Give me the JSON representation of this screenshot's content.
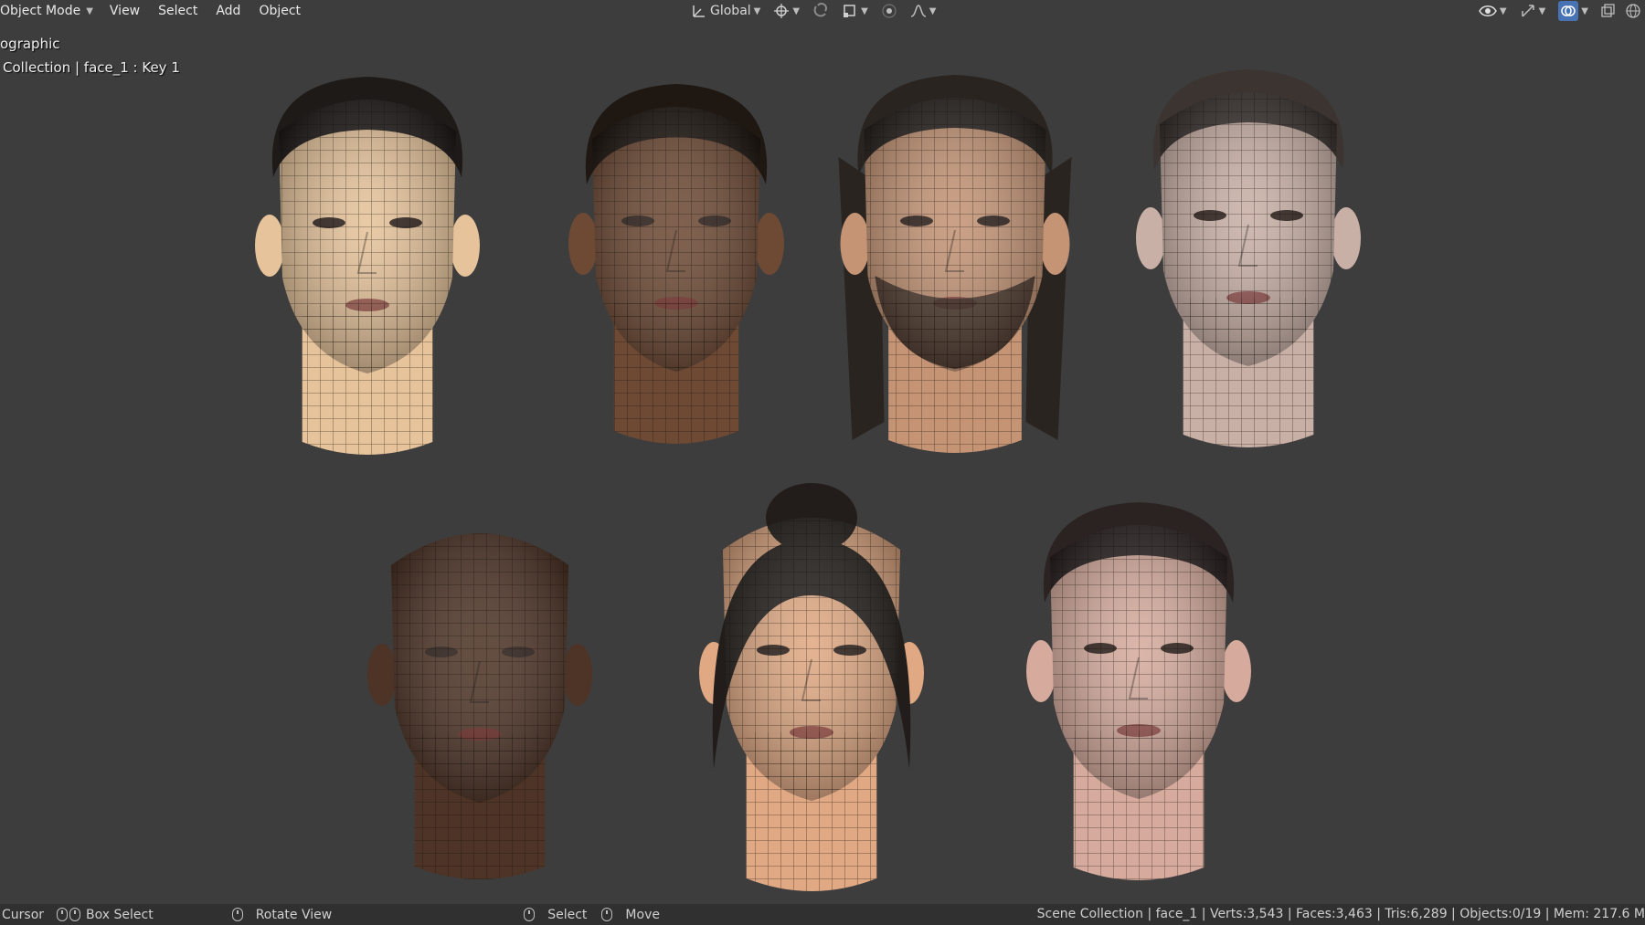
{
  "header": {
    "mode": "Object Mode",
    "menus": [
      "View",
      "Select",
      "Add",
      "Object"
    ],
    "orientation": "Global"
  },
  "viewport": {
    "view_label": "ographic",
    "collection_label": "Collection | face_1 : Key 1",
    "heads": [
      {
        "name": "woman short black hair",
        "skin": "#e6c39a",
        "hair": "#1e1a18"
      },
      {
        "name": "woman dark skin short hair",
        "skin": "#6e4a35",
        "hair": "#1f1712"
      },
      {
        "name": "man long hair beard",
        "skin": "#c49475",
        "hair": "#2a2420"
      },
      {
        "name": "man grey skin",
        "skin": "#c9b0a6",
        "hair": "#3b3431"
      },
      {
        "name": "bald man dark skin",
        "skin": "#4e3426",
        "hair": "#3e2a1f"
      },
      {
        "name": "woman hair bun",
        "skin": "#e0a983",
        "hair": "#221d1a"
      },
      {
        "name": "man short dark hair",
        "skin": "#d6ab9d",
        "hair": "#2b2322"
      }
    ]
  },
  "statusbar": {
    "cursor": "Cursor",
    "box_select": "Box Select",
    "rotate_view": "Rotate View",
    "select": "Select",
    "move": "Move",
    "stats": "Scene Collection | face_1 | Verts:3,543 | Faces:3,463 | Tris:6,289 | Objects:0/19 | Mem: 217.6 M"
  },
  "colors": {
    "background": "#3d3d3d",
    "statusbar": "#303030",
    "accent": "#4772b3"
  }
}
